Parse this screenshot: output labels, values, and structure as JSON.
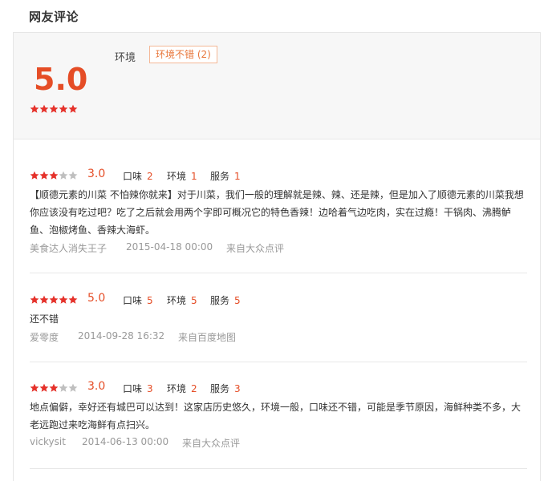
{
  "section_title": "网友评论",
  "summary": {
    "score": "5.0",
    "rating": 5,
    "tag_label": "环境",
    "tag_text": "环境不错 (2)"
  },
  "colors": {
    "accent": "#e54d26",
    "star_on": "#e5312a",
    "star_off": "#bfbfbf",
    "tag_border": "#f4b896"
  },
  "labels": {
    "taste": "口味",
    "environment": "环境",
    "service": "服务"
  },
  "reviews": [
    {
      "rating": 3,
      "score": "3.0",
      "taste": "2",
      "environment": "1",
      "service": "1",
      "content": "【顺德元素的川菜 不怕辣你就来】对于川菜，我们一般的理解就是辣、辣、还是辣，但是加入了顺德元素的川菜我想你应该没有吃过吧？吃了之后就会用两个字即可概况它的特色香辣！边哈着气边吃肉，实在过瘾！干锅肉、沸腾鲈鱼、泡椒烤鱼、香辣大海虾。",
      "user": "美食达人消失王子",
      "time": "2015-04-18 00:00",
      "source": "来自大众点评"
    },
    {
      "rating": 5,
      "score": "5.0",
      "taste": "5",
      "environment": "5",
      "service": "5",
      "content": "还不错",
      "user": "爱零度",
      "time": "2014-09-28 16:32",
      "source": "来自百度地图"
    },
    {
      "rating": 3,
      "score": "3.0",
      "taste": "3",
      "environment": "2",
      "service": "3",
      "content": "地点偏僻，幸好还有城巴可以达到！这家店历史悠久，环境一般，口味还不错，可能是季节原因，海鲜种类不多，大老远跑过来吃海鲜有点扫兴。",
      "user": "vickysit",
      "time": "2014-06-13 00:00",
      "source": "来自大众点评"
    }
  ]
}
